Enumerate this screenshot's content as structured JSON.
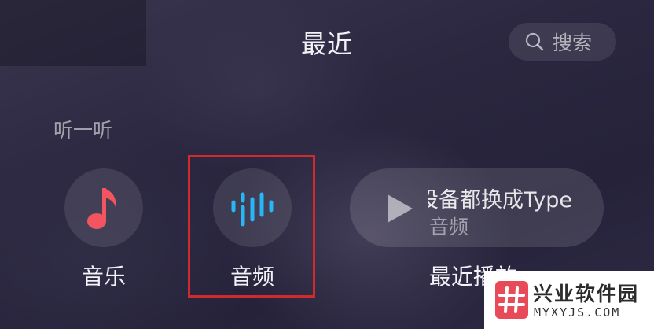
{
  "header": {
    "title": "最近",
    "search": {
      "label": "搜索",
      "icon": "search-icon"
    }
  },
  "section": {
    "label": "听一听"
  },
  "items": [
    {
      "label": "音乐",
      "icon": "music-note-icon",
      "icon_color": "#f2555f"
    },
    {
      "label": "音频",
      "icon": "audio-wave-icon",
      "icon_color": "#29b6f6",
      "highlighted": true
    },
    {
      "label": "最近播放",
      "icon": "play-icon"
    }
  ],
  "recent_card": {
    "title": "设备都换成Type",
    "subtitle": "音频"
  },
  "watermark": {
    "brand": "兴业软件园",
    "url": "MYXYJS.COM",
    "accent_color": "#e84a59"
  },
  "colors": {
    "highlight_border": "#d02a2c",
    "background": "#2b2740"
  }
}
